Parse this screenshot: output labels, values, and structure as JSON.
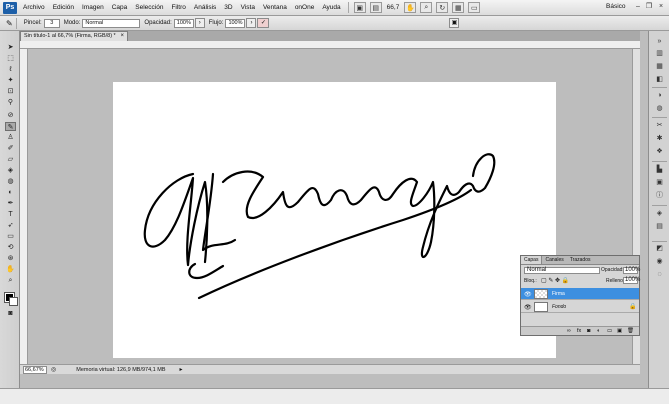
{
  "app": {
    "logo": "Ps",
    "menu": [
      "Archivo",
      "Edición",
      "Imagen",
      "Capa",
      "Selección",
      "Filtro",
      "Análisis",
      "3D",
      "Vista",
      "Ventana",
      "onOne",
      "Ayuda"
    ],
    "zoom_display": "66,7",
    "workspace": "Básico",
    "window_controls": {
      "minimize": "–",
      "restore": "❐",
      "close": "×"
    }
  },
  "options_bar": {
    "brush_label": "Pincel:",
    "brush_size": "3",
    "mode_label": "Modo:",
    "mode_value": "Normal",
    "opacity_label": "Opacidad:",
    "opacity_value": "100%",
    "flow_label": "Flujo:",
    "flow_value": "100%"
  },
  "document": {
    "tab_title": "Sin título-1 al 66,7% (Firma, RGB/8) *",
    "tab_close": "×",
    "status_zoom": "66,67%",
    "status_info": "Memoria virtual: 126,9 MB/974,1 MB"
  },
  "layers_panel": {
    "tabs": [
      "Capas",
      "Canales",
      "Trazados"
    ],
    "blend_mode": "Normal",
    "opacity_label": "Opacidad:",
    "opacity_value": "100%",
    "lock_label": "Bloq.:",
    "fill_label": "Relleno:",
    "fill_value": "100%",
    "layers": [
      {
        "name": "Firma",
        "selected": true
      },
      {
        "name": "Fondo",
        "selected": false
      }
    ]
  },
  "colors": {
    "foreground": "#000000",
    "background": "#ffffff",
    "selection_blue": "#3d8fe0"
  }
}
